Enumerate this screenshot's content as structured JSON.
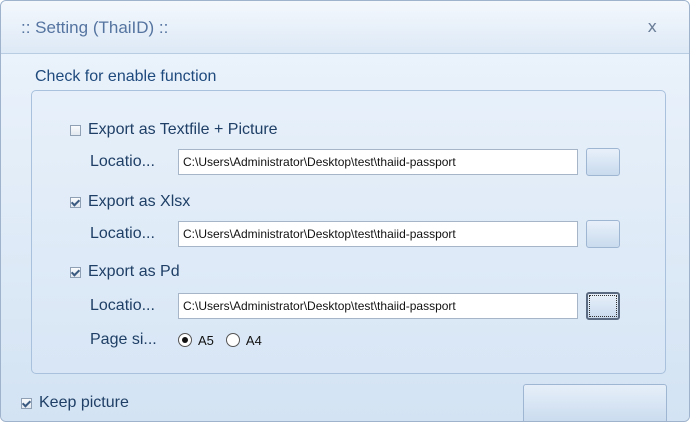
{
  "window": {
    "title": ":: Setting (ThaiID) ::",
    "close_glyph": "x"
  },
  "group": {
    "label": "Check for enable function"
  },
  "export_text": {
    "label": "Export as Textfile + Picture",
    "checked": false,
    "location_label": "Locatio...",
    "location_value": "C:\\Users\\Administrator\\Desktop\\test\\thaiid-passport"
  },
  "export_xlsx": {
    "label": "Export as Xlsx",
    "checked": true,
    "location_label": "Locatio...",
    "location_value": "C:\\Users\\Administrator\\Desktop\\test\\thaiid-passport"
  },
  "export_pdf": {
    "label": "Export as Pd",
    "checked": true,
    "location_label": "Locatio...",
    "location_value": "C:\\Users\\Administrator\\Desktop\\test\\thaiid-passport"
  },
  "page_size": {
    "label": "Page si...",
    "options": [
      "A5",
      "A4"
    ],
    "selected": "A5"
  },
  "keep_picture": {
    "label": "Keep picture",
    "checked": true
  },
  "colors": {
    "title_text": "#5574a0",
    "label_text": "#1f3f66",
    "panel_bg": "#dce8f5"
  }
}
